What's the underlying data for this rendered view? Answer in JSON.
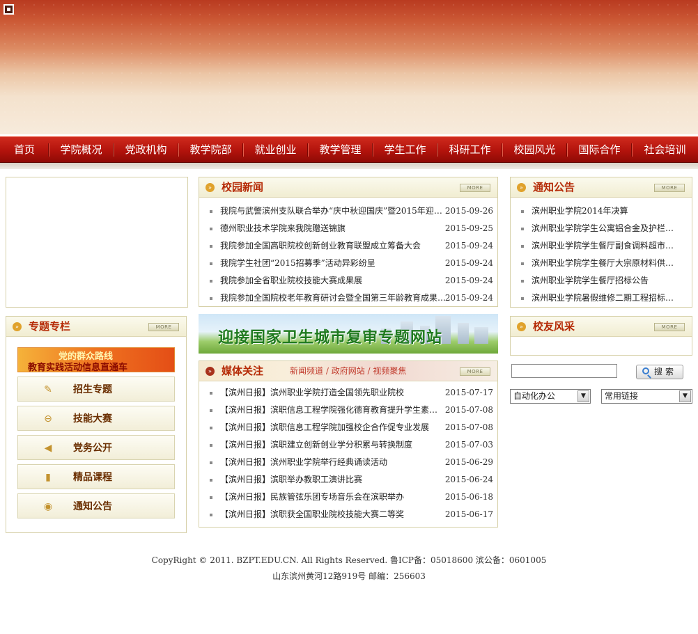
{
  "nav": [
    "首页",
    "学院概况",
    "党政机构",
    "教学院部",
    "就业创业",
    "教学管理",
    "学生工作",
    "科研工作",
    "校园风光",
    "国际合作",
    "社会培训"
  ],
  "more_label": "MORE",
  "news": {
    "title": "校园新闻",
    "items": [
      {
        "title": "我院与武警滨州支队联合举办“庆中秋迎国庆”暨2015年迎新…",
        "date": "2015-09-26"
      },
      {
        "title": "德州职业技术学院来我院赠送锦旗",
        "date": "2015-09-25"
      },
      {
        "title": "我院参加全国高职院校创新创业教育联盟成立筹备大会",
        "date": "2015-09-24"
      },
      {
        "title": "我院学生社团“2015招募季”活动异彩纷呈",
        "date": "2015-09-24"
      },
      {
        "title": "我院参加全省职业院校技能大赛成果展",
        "date": "2015-09-24"
      },
      {
        "title": "我院参加全国院校老年教育研讨会暨全国第三年龄教育成果…",
        "date": "2015-09-24"
      }
    ]
  },
  "notice": {
    "title": "通知公告",
    "items": [
      "滨州职业学院2014年决算",
      "滨州职业学院学生公寓铝合金及护栏…",
      "滨州职业学院学生餐厅副食调料超市…",
      "滨州职业学院学生餐厅大宗原材料供…",
      "滨州职业学院学生餐厅招标公告",
      "滨州职业学院暑假维修二期工程招标…"
    ]
  },
  "special": {
    "title": "专题专栏",
    "party_line1": "党的群众路线",
    "party_line2": "教育实践活动信息直通车",
    "buttons": [
      {
        "label": "招生专题",
        "icon": "✎"
      },
      {
        "label": "技能大赛",
        "icon": "⊖"
      },
      {
        "label": "党务公开",
        "icon": "◀"
      },
      {
        "label": "精品课程",
        "icon": "▮"
      },
      {
        "label": "通知公告",
        "icon": "◉"
      }
    ]
  },
  "health_banner": "迎接国家卫生城市复审专题网站",
  "media": {
    "title": "媒体关注",
    "links": [
      "新闻频道",
      "政府网站",
      "视频聚焦"
    ],
    "items": [
      {
        "title": "【滨州日报】滨州职业学院打造全国领先职业院校",
        "date": "2015-07-17"
      },
      {
        "title": "【滨州日报】滨职信息工程学院强化德育教育提升学生素…",
        "date": "2015-07-08"
      },
      {
        "title": "【滨州日报】滨职信息工程学院加强校企合作促专业发展",
        "date": "2015-07-08"
      },
      {
        "title": "【滨州日报】滨职建立创新创业学分积累与转换制度",
        "date": "2015-07-03"
      },
      {
        "title": "【滨州日报】滨州职业学院举行经典诵读活动",
        "date": "2015-06-29"
      },
      {
        "title": "【滨州日报】滨职举办教职工演讲比赛",
        "date": "2015-06-24"
      },
      {
        "title": "【滨州日报】民族管弦乐团专场音乐会在滨职举办",
        "date": "2015-06-18"
      },
      {
        "title": "【滨州日报】滨职获全国职业院校技能大赛二等奖",
        "date": "2015-06-17"
      }
    ]
  },
  "alumni": {
    "title": "校友风采"
  },
  "search": {
    "button": "搜索",
    "value": ""
  },
  "selects": {
    "office": "自动化办公",
    "links": "常用链接"
  },
  "footer": {
    "line1": "CopyRight © 2011. BZPT.EDU.CN. All Rights Reserved. 鲁ICP备：05018600 滨公备：0601005",
    "line2": "山东滨州黄河12路919号  邮编：256603"
  }
}
